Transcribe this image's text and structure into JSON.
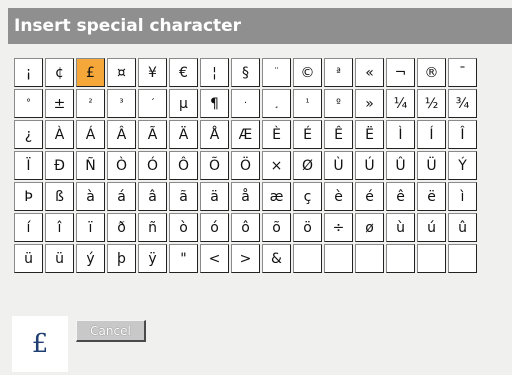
{
  "dialog": {
    "title": "Insert special character",
    "selected_character": "£",
    "cancel_label": "Cancel"
  },
  "grid": {
    "rows": [
      [
        "¡",
        "¢",
        "£",
        "¤",
        "¥",
        "€",
        "¦",
        "§",
        "¨",
        "©",
        "ª",
        "«",
        "¬",
        "®",
        "¯"
      ],
      [
        "°",
        "±",
        "²",
        "³",
        "´",
        "µ",
        "¶",
        "·",
        "¸",
        "¹",
        "º",
        "»",
        "¼",
        "½",
        "¾"
      ],
      [
        "¿",
        "À",
        "Á",
        "Â",
        "Ã",
        "Ä",
        "Å",
        "Æ",
        "È",
        "É",
        "Ê",
        "Ë",
        "Ì",
        "Í",
        "Î"
      ],
      [
        "Ï",
        "Ð",
        "Ñ",
        "Ò",
        "Ó",
        "Ô",
        "Õ",
        "Ö",
        "×",
        "Ø",
        "Ù",
        "Ú",
        "Û",
        "Ü",
        "Ý"
      ],
      [
        "Þ",
        "ß",
        "à",
        "á",
        "â",
        "ã",
        "ä",
        "å",
        "æ",
        "ç",
        "è",
        "é",
        "ê",
        "ë",
        "ì"
      ],
      [
        "í",
        "î",
        "ï",
        "ð",
        "ñ",
        "ò",
        "ó",
        "ô",
        "õ",
        "ö",
        "÷",
        "ø",
        "ù",
        "ú",
        "û"
      ],
      [
        "ü",
        "ü",
        "ý",
        "þ",
        "ÿ",
        "\"",
        "<",
        ">",
        "&",
        "",
        "",
        "",
        "",
        "",
        ""
      ]
    ]
  },
  "colors": {
    "title_bar": "#8f8f8f",
    "selected_cell": "#f5a73a",
    "preview_text": "#1f3f73"
  }
}
